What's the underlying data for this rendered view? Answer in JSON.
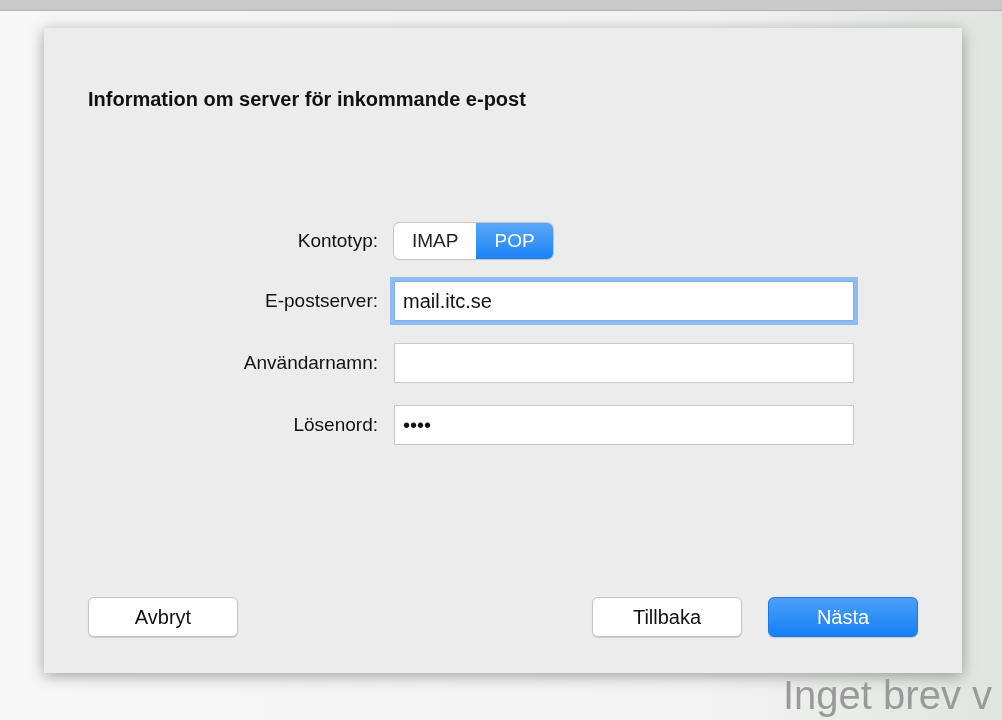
{
  "dialog": {
    "title": "Information om server för inkommande e-post",
    "account_type": {
      "label": "Kontotyp:",
      "options": [
        {
          "label": "IMAP",
          "selected": false
        },
        {
          "label": "POP",
          "selected": true
        }
      ]
    },
    "fields": [
      {
        "label": "E-postserver:",
        "value": "mail.itc.se",
        "focused": true
      },
      {
        "label": "Användarnamn:",
        "focused": false
      },
      {
        "label": "Lösenord:",
        "value": "••••",
        "focused": false
      }
    ],
    "buttons_left": [
      {
        "label": "Avbryt",
        "kind": "default"
      }
    ],
    "buttons_right": [
      {
        "label": "Tillbaka",
        "kind": "default"
      },
      {
        "label": "Nästa",
        "kind": "primary"
      }
    ]
  },
  "background_text": "Inget brev v"
}
